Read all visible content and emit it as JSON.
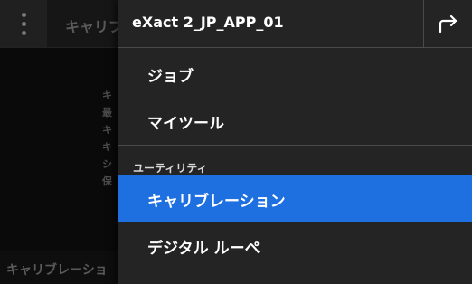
{
  "background": {
    "title": "キャリブ",
    "info_lines": [
      "キ",
      "最",
      "キ",
      "キ",
      "シ",
      "保"
    ],
    "footer_title": "キャリブレーショ"
  },
  "drawer": {
    "title": "eXact 2_JP_APP_01",
    "exit_icon": "exit-arrow-icon",
    "items": [
      {
        "label": "ジョブ",
        "selected": false
      },
      {
        "label": "マイツール",
        "selected": false
      }
    ],
    "section_label": "ユーティリティ",
    "utility_items": [
      {
        "label": "キャリブレーション",
        "selected": true
      },
      {
        "label": "デジタル ルーペ",
        "selected": false
      }
    ]
  },
  "colors": {
    "selected": "#1e6fe0",
    "drawer_bg": "#242424"
  }
}
